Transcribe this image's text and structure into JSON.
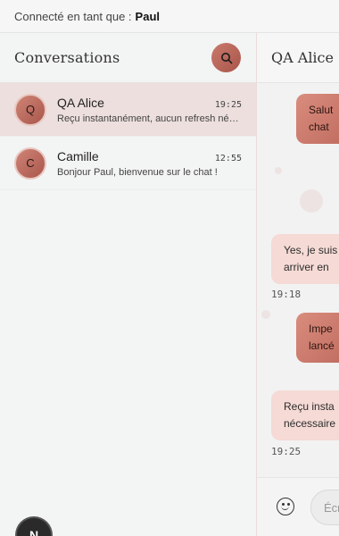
{
  "topbar": {
    "prefix": "Connecté en tant que :",
    "username": "Paul"
  },
  "sidebar": {
    "title": "Conversations",
    "search_icon": "search-icon",
    "conversations": [
      {
        "initial": "Q",
        "name": "QA Alice",
        "time": "19:25",
        "preview": "Reçu instantanément, aucun refresh nécessaire !",
        "active": true
      },
      {
        "initial": "C",
        "name": "Camille",
        "time": "12:55",
        "preview": "Bonjour Paul, bienvenue sur le chat !",
        "active": false
      }
    ],
    "bottom_button_label": "N"
  },
  "chat": {
    "title": "QA Alice",
    "messages": [
      {
        "direction": "sent",
        "lines": [
          "Salut",
          "chat"
        ]
      },
      {
        "direction": "received",
        "lines": [
          "Yes, je suis",
          "arriver en"
        ],
        "time": "19:18"
      },
      {
        "direction": "sent",
        "lines": [
          "Impe",
          "lancé"
        ]
      },
      {
        "direction": "received",
        "lines": [
          "Reçu insta",
          "nécessaire"
        ],
        "time": "19:25"
      }
    ],
    "composer": {
      "emoji_icon": "smiley-icon",
      "placeholder": "Écrire un message..."
    }
  },
  "colors": {
    "accent": "#c26f62",
    "active_row": "#ecdfdd",
    "received_bubble": "#f5dad5"
  }
}
